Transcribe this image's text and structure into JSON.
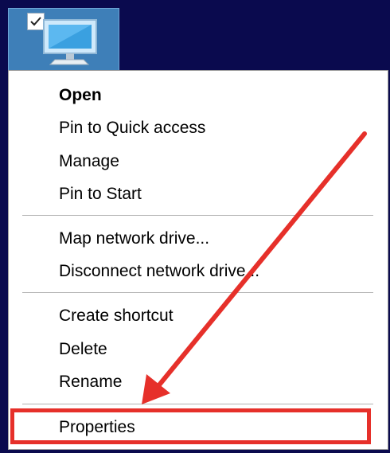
{
  "desktop": {
    "icon_name": "this-pc-icon",
    "selected": true
  },
  "context_menu": {
    "items": [
      {
        "label": "Open",
        "bold": true
      },
      {
        "label": "Pin to Quick access"
      },
      {
        "label": "Manage"
      },
      {
        "label": "Pin to Start"
      },
      {
        "label": "Map network drive..."
      },
      {
        "label": "Disconnect network drive..."
      },
      {
        "label": "Create shortcut"
      },
      {
        "label": "Delete"
      },
      {
        "label": "Rename"
      },
      {
        "label": "Properties"
      }
    ]
  },
  "annotation": {
    "color": "#e6302a",
    "target": "Properties"
  }
}
